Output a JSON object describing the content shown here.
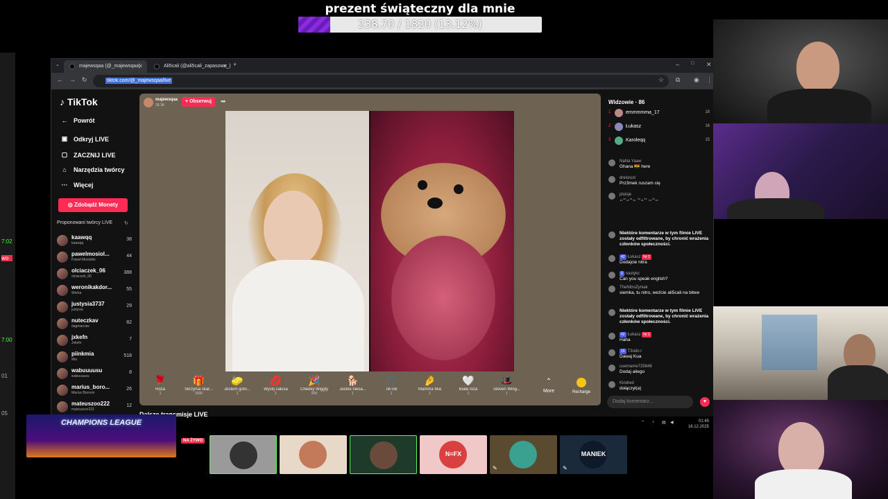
{
  "goal": {
    "title": "prezent świąteczny dla mnie",
    "progress_text": "238.70 / 1820 (13.12%)",
    "progress": 0.1312,
    "fill_color": "#8a2be2"
  },
  "left_strip": {
    "marks": [
      "7:02",
      "wo",
      "7:00",
      "01",
      "05"
    ]
  },
  "browser": {
    "tabs": [
      {
        "title": "majewsqaa (@_majewsqaa)",
        "active": true
      },
      {
        "title": "Ali5cali (@ali5cali_zapasowe_) p",
        "active": false
      }
    ],
    "new_tab": "+",
    "window_controls": [
      "v",
      "–",
      "□",
      "✕"
    ],
    "url": "tiktok.com/@_majewsqaa/live"
  },
  "tiktok": {
    "logo": "TikTok",
    "nav": [
      {
        "label": "Powrót",
        "icon": "arrow-left-icon"
      },
      {
        "label": "Odkryj LIVE",
        "icon": "live-icon"
      },
      {
        "label": "ZACZNIJ LIVE",
        "icon": "camera-icon"
      },
      {
        "label": "Narzędzia twórcy",
        "icon": "house-icon"
      },
      {
        "label": "Więcej",
        "icon": "dots-icon"
      }
    ],
    "coins_button": "Zdobądź Monety",
    "suggested_title": "Proponowani twórcy LIVE",
    "creators": [
      {
        "name": "kaawqq",
        "sub": "kaawqq",
        "count": "38"
      },
      {
        "name": "pawelmosiol...",
        "sub": "Paweł Mosiołek",
        "count": "44"
      },
      {
        "name": "olciaczek_06",
        "sub": "olciaczek_06",
        "count": "388"
      },
      {
        "name": "weronikakdor...",
        "sub": "Werka",
        "count": "55"
      },
      {
        "name": "justysia3737",
        "sub": "justysia",
        "count": "29"
      },
      {
        "name": "nuteczkav",
        "sub": "dagmarciav",
        "count": "82"
      },
      {
        "name": "jxkefn",
        "sub": "Jxkefn",
        "count": "7"
      },
      {
        "name": "piinkmia",
        "sub": "Mia",
        "count": "518"
      },
      {
        "name": "wabuuuusu",
        "sub": "wabuuuusu",
        "count": "8"
      },
      {
        "name": "marius_boro...",
        "sub": "Marius Borovin",
        "count": "26"
      },
      {
        "name": "mateuszoo222",
        "sub": "mateuszoo222",
        "count": "12"
      }
    ],
    "streamer": {
      "name": "majewsqaa",
      "likes": "28.3K",
      "follow_label": "+ Obserwuj"
    },
    "gifts": [
      {
        "name": "Róża",
        "price": "1",
        "icon": "🌹"
      },
      {
        "name": "Skrzynia skar...",
        "price": "1500",
        "icon": "🎁"
      },
      {
        "name": "Jestem goto...",
        "price": "1",
        "icon": "🧽"
      },
      {
        "name": "Wyślij całusa",
        "price": "1",
        "icon": "💋"
      },
      {
        "name": "Cheeky Wiggly",
        "price": "500",
        "icon": "🎉"
      },
      {
        "name": "Jesteś niesa...",
        "price": "1",
        "icon": "🐕"
      },
      {
        "name": "TikTok",
        "price": "1",
        "icon": "🎵"
      },
      {
        "name": "Mamma Mia",
        "price": "1",
        "icon": "🤌"
      },
      {
        "name": "Biała róża",
        "price": "1",
        "icon": "🤍"
      },
      {
        "name": "Steven Wing...",
        "price": "1",
        "icon": "🎩"
      }
    ],
    "more_label": "More",
    "recharge_label": "Recharge",
    "more_live": "Dalsze transmisje LIVE",
    "chat": {
      "viewers_title": "Widzowie · 86",
      "viewers": [
        {
          "rank": "1",
          "name": "emmmmma_17",
          "score": "18"
        },
        {
          "rank": "2",
          "name": "Łukasz",
          "score": "16"
        },
        {
          "rank": "3",
          "name": "Karoleqq",
          "score": "15"
        }
      ],
      "messages": [
        {
          "user": "NaNa Yaaw",
          "text": "Ghana 🇬🇭 here"
        },
        {
          "user": "dreisrust",
          "text": "Prz3mek ruszam cię"
        },
        {
          "user": "pluisje",
          "text": "⠤⠒⠤⠒⠤ ⠒⠤⠒ ⠤⠒⠤"
        },
        {
          "user": "",
          "text": "Niektóre komentarze w tym filmie LIVE zostały odfiltrowane, by chronić wrażenia członków społeczności."
        },
        {
          "user": "Łukasz",
          "text": "Dodajcie nitra",
          "badge": "42",
          "badge2": "Nr 2"
        },
        {
          "user": "nastykc",
          "text": "Can you speak english?",
          "badge": "9"
        },
        {
          "user": "TheNitroZyniak",
          "text": "siemka, tu nitro, weźcie ali5cali na bitwe"
        },
        {
          "user": "",
          "text": "Niektóre komentarze w tym filmie LIVE zostały odfiltrowane, by chronić wrażenia członków społeczności."
        },
        {
          "user": "Łukasz",
          "text": "Haha",
          "badge": "42",
          "badge2": "Nr 2"
        },
        {
          "user": "T3odo.r",
          "text": "Dawaj Kua",
          "badge": "15"
        },
        {
          "user": "username725648",
          "text": "Dodaj aliego"
        },
        {
          "user": "Kindred",
          "text": "dołączył(a)"
        }
      ],
      "input_placeholder": "Dodaj komentarz..."
    }
  },
  "tray": {
    "time": "01:45",
    "date": "16.12.2025"
  },
  "bottom": {
    "banner_text": "CHAMPIONS LEAGUE",
    "live_badge": "NA ŻYWO",
    "thumbs": [
      {
        "label": "",
        "bg": "#9a9a9a",
        "avatar": "#333"
      },
      {
        "label": "",
        "bg": "#e8d8c8",
        "avatar": "#c27a5a"
      },
      {
        "label": "",
        "bg": "#1e3a2a",
        "avatar": "#6a4a3a"
      },
      {
        "label": "N≡FX",
        "bg": "#f0c8c8",
        "avatar": "#d94040"
      },
      {
        "label": "",
        "bg": "#5a4a30",
        "avatar": "#3aa090"
      },
      {
        "label": "MANIEK",
        "bg": "#1a2a3a",
        "avatar": "#0e1a2a"
      }
    ]
  }
}
